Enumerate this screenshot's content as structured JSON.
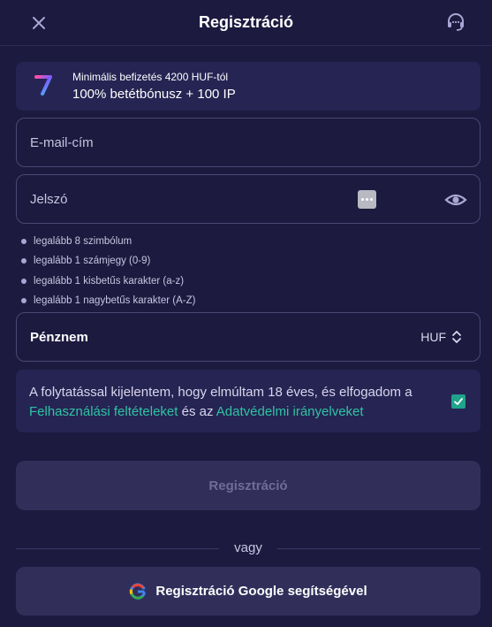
{
  "header": {
    "title": "Regisztráció",
    "close_icon": "close-icon",
    "support_icon": "headset-icon"
  },
  "bonus": {
    "logo_icon": "seven-logo-icon",
    "line1": "Minimális befizetés 4200 HUF-tól",
    "line2": "100% betétbónusz + 100 IP"
  },
  "form": {
    "email_placeholder": "E-mail-cím",
    "email_value": "",
    "password_placeholder": "Jelszó",
    "password_value": "",
    "password_rules": [
      "legalább 8 szimbólum",
      "legalább 1 számjegy (0-9)",
      "legalább 1 kisbetűs karakter (a-z)",
      "legalább 1 nagybetűs karakter (A-Z)"
    ],
    "currency_label": "Pénznem",
    "currency_value": "HUF",
    "consent": {
      "text_before": "A folytatással kijelentem, hogy elmúltam 18 éves, és elfogadom a ",
      "link1": "Felhasználási feltételeket",
      "text_middle": " és az ",
      "link2": "Adatvédelmi irányelveket",
      "checked": true
    },
    "submit_label": "Regisztráció",
    "or_label": "vagy",
    "google_label": "Regisztráció Google segítségével"
  },
  "colors": {
    "background": "#1c1a3f",
    "panel": "#262453",
    "button": "#312f5a",
    "accent_link": "#2ec4a2",
    "checkbox": "#1fa38a"
  }
}
